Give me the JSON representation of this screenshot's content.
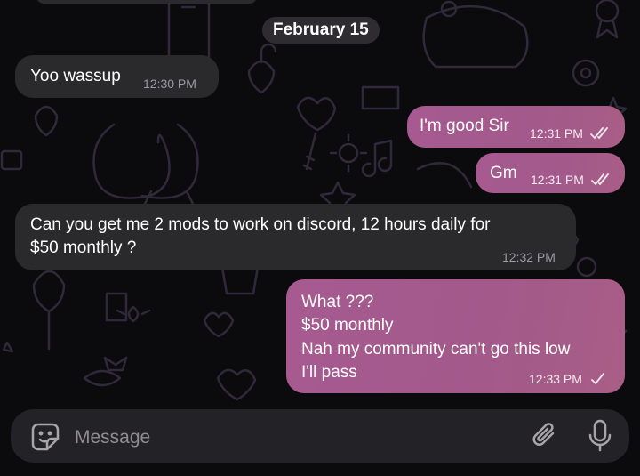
{
  "chat": {
    "date_label": "February 15",
    "messages": [
      {
        "direction": "incoming",
        "text": "Yoo wassup",
        "time": "12:30 PM"
      },
      {
        "direction": "outgoing",
        "text": "I'm good Sir",
        "time": "12:31 PM",
        "status": "read"
      },
      {
        "direction": "outgoing",
        "text": "Gm",
        "time": "12:31 PM",
        "status": "read"
      },
      {
        "direction": "incoming",
        "text_lines": [
          "Can you get me 2 mods to work on discord, 12 hours daily for",
          "$50 monthly ?"
        ],
        "time": "12:32 PM"
      },
      {
        "direction": "outgoing",
        "text_lines": [
          "What ???",
          "$50 monthly",
          "Nah my community can't go this low",
          "I'll pass"
        ],
        "time": "12:33 PM",
        "status": "sent"
      }
    ]
  },
  "composer": {
    "placeholder": "Message",
    "icons": [
      "sticker-icon",
      "paperclip-icon",
      "microphone-icon"
    ]
  },
  "colors": {
    "background": "#0b0a0d",
    "incoming_bubble": "#2a292c",
    "outgoing_bubble": "#a65a91",
    "doodle_stroke": "#2f2a3a"
  }
}
